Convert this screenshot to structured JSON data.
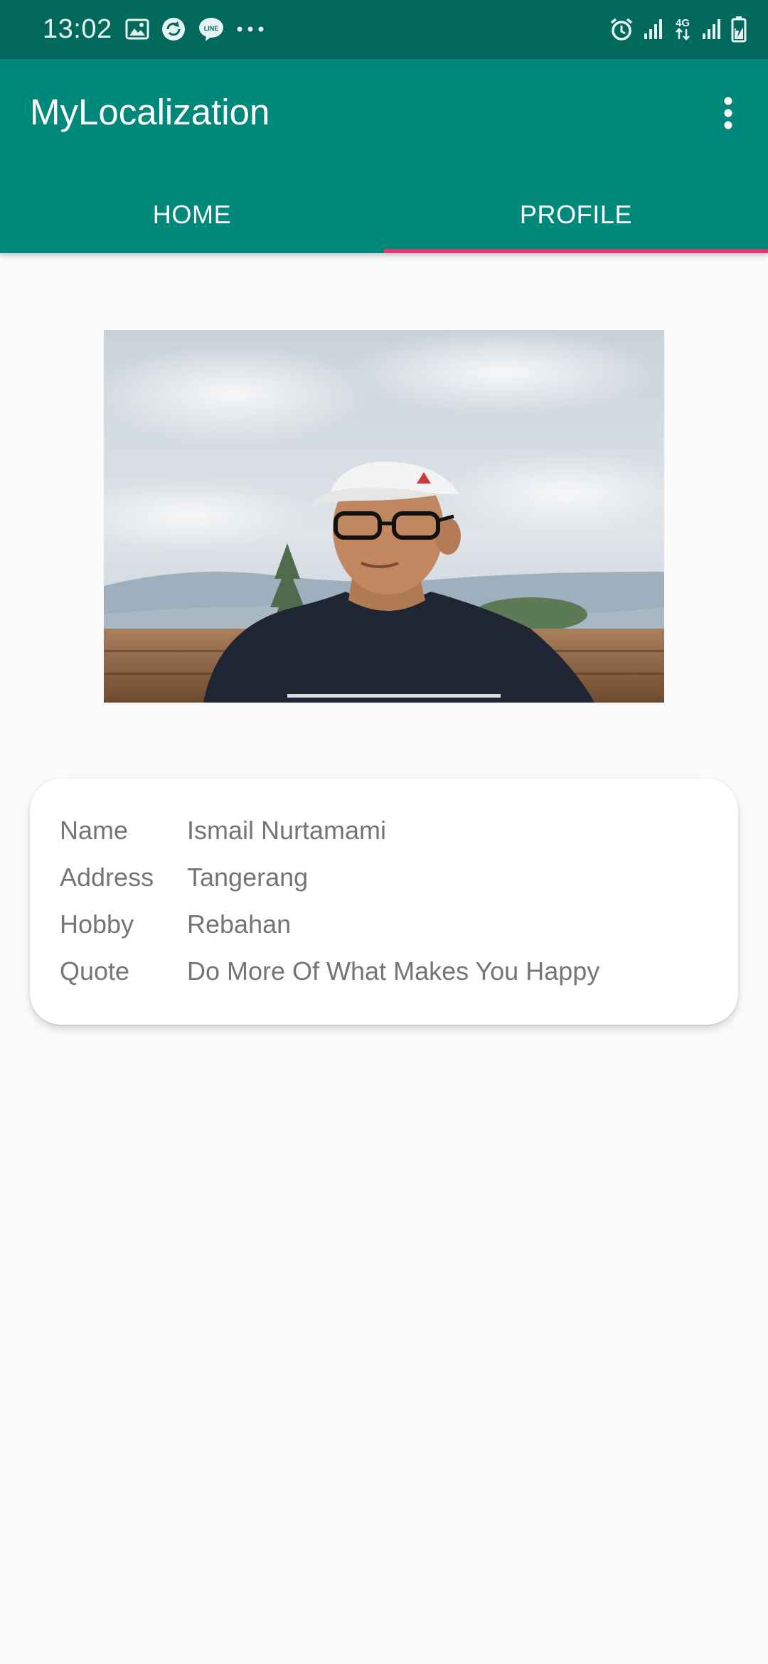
{
  "status_bar": {
    "time": "13:02",
    "left_icons": [
      "image-icon",
      "sync-app-icon",
      "line-app-icon",
      "more-dots-icon"
    ],
    "network_label": "4G",
    "right_icons": [
      "alarm-icon",
      "signal-icon",
      "network-4g-icon",
      "signal-icon",
      "battery-charging-icon"
    ]
  },
  "app_bar": {
    "title": "MyLocalization",
    "overflow_icon": "more-vert-icon",
    "background": "#00897b",
    "status_background": "#00695c",
    "indicator_color": "#e5396b"
  },
  "tabs": [
    {
      "label": "HOME",
      "selected": false
    },
    {
      "label": "PROFILE",
      "selected": true
    }
  ],
  "profile": {
    "photo": "profile-photo",
    "fields": [
      {
        "label": "Name",
        "value": "Ismail Nurtamami"
      },
      {
        "label": "Address",
        "value": "Tangerang"
      },
      {
        "label": "Hobby",
        "value": "Rebahan"
      },
      {
        "label": "Quote",
        "value": "Do More Of What Makes You Happy"
      }
    ]
  }
}
